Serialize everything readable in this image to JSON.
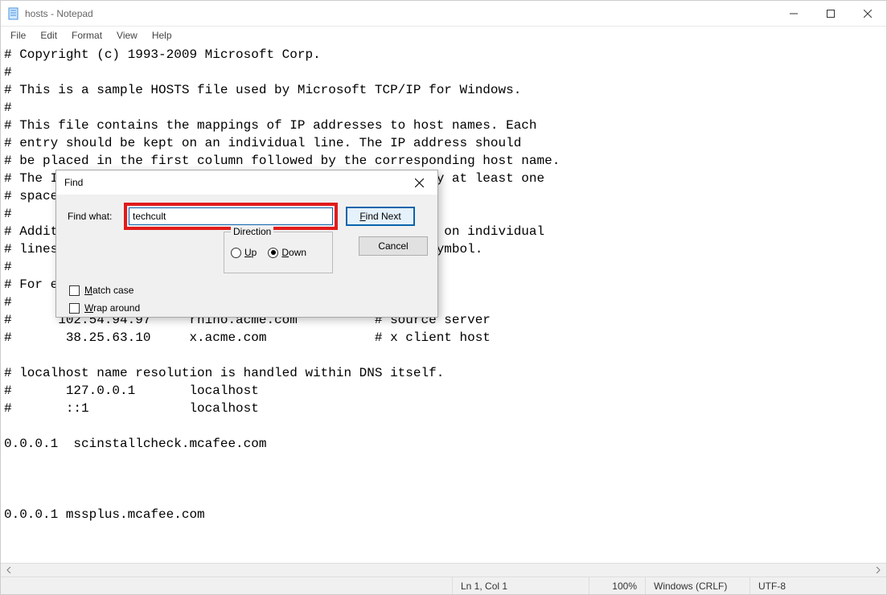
{
  "window": {
    "title": "hosts - Notepad"
  },
  "menu": {
    "file": "File",
    "edit": "Edit",
    "format": "Format",
    "view": "View",
    "help": "Help"
  },
  "content": "# Copyright (c) 1993-2009 Microsoft Corp.\n#\n# This is a sample HOSTS file used by Microsoft TCP/IP for Windows.\n#\n# This file contains the mappings of IP addresses to host names. Each\n# entry should be kept on an individual line. The IP address should\n# be placed in the first column followed by the corresponding host name.\n# The IP address and the host name should be separated by at least one\n# space.\n#\n# Additionally, comments (such as these) may be inserted on individual\n# lines or following the machine name denoted by a '#' symbol.\n#\n# For example:\n#\n#      102.54.94.97     rhino.acme.com          # source server\n#       38.25.63.10     x.acme.com              # x client host\n\n# localhost name resolution is handled within DNS itself.\n#       127.0.0.1       localhost\n#       ::1             localhost\n\n0.0.0.1  scinstallcheck.mcafee.com\n\n\n\n0.0.0.1 mssplus.mcafee.com",
  "status": {
    "pos": "Ln 1, Col 1",
    "zoom": "100%",
    "eol": "Windows (CRLF)",
    "encoding": "UTF-8"
  },
  "dialog": {
    "title": "Find",
    "find_what_label": "Find what:",
    "find_value": "techcult",
    "find_next": "Find Next",
    "cancel": "Cancel",
    "match_case": "Match case",
    "wrap_around": "Wrap around",
    "direction_label": "Direction",
    "up": "Up",
    "down": "Down"
  }
}
